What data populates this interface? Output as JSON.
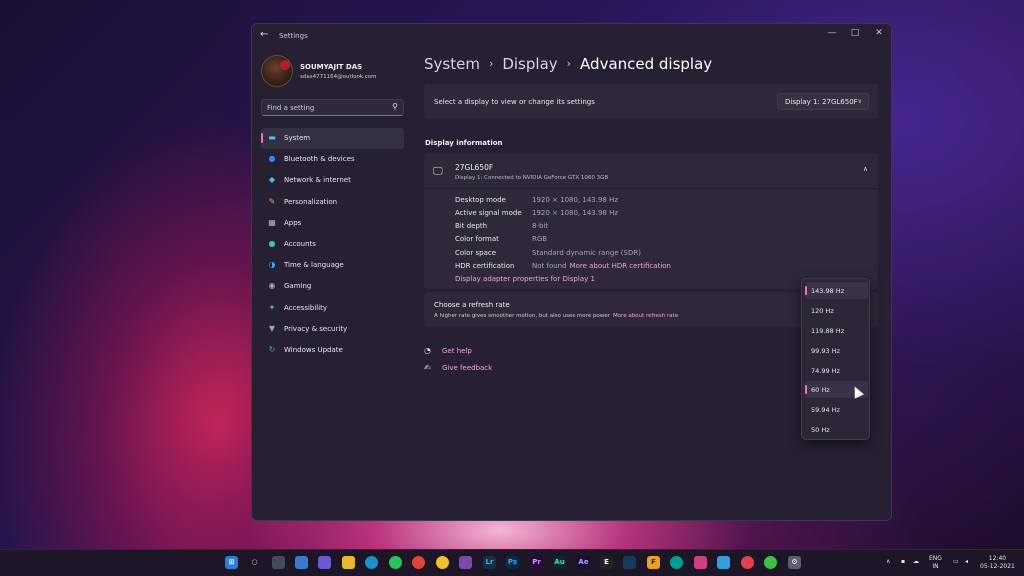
{
  "window": {
    "title": "Settings",
    "back_icon": "←",
    "min_icon": "—",
    "max_icon": "□",
    "close_icon": "✕"
  },
  "profile": {
    "name": "SOUMYAJIT DAS",
    "email": "sdas4771164@outlook.com"
  },
  "search": {
    "placeholder": "Find a setting",
    "icon": "⚲"
  },
  "sidebar": {
    "items": [
      {
        "label": "System",
        "icon": "▬",
        "color": "#4cc2ff"
      },
      {
        "label": "Bluetooth & devices",
        "icon": "●",
        "color": "#2f8cff"
      },
      {
        "label": "Network & internet",
        "icon": "◆",
        "color": "#54b6f6"
      },
      {
        "label": "Personalization",
        "icon": "✎",
        "color": "#f0a050"
      },
      {
        "label": "Apps",
        "icon": "▦",
        "color": "#b0b8d8"
      },
      {
        "label": "Accounts",
        "icon": "●",
        "color": "#3cc8a0"
      },
      {
        "label": "Time & language",
        "icon": "◑",
        "color": "#3aa6f0"
      },
      {
        "label": "Gaming",
        "icon": "◉",
        "color": "#a8a8b8"
      },
      {
        "label": "Accessibility",
        "icon": "✦",
        "color": "#4ab0ff"
      },
      {
        "label": "Privacy & security",
        "icon": "▼",
        "color": "#9aa0b0"
      },
      {
        "label": "Windows Update",
        "icon": "↻",
        "color": "#3aa0f0"
      }
    ]
  },
  "breadcrumb": {
    "part1": "System",
    "part2": "Display",
    "current": "Advanced display",
    "sep": "›"
  },
  "display_select": {
    "label": "Select a display to view or change its settings",
    "value": "Display 1: 27GL650F",
    "chevron": "∨"
  },
  "display_info": {
    "section_title": "Display information",
    "name": "27GL650F",
    "subtitle": "Display 1: Connected to NVIDIA GeForce GTX 1060 3GB",
    "chevron": "∧",
    "rows": [
      {
        "key": "Desktop mode",
        "value": "1920 × 1080, 143.98 Hz"
      },
      {
        "key": "Active signal mode",
        "value": "1920 × 1080, 143.98 Hz"
      },
      {
        "key": "Bit depth",
        "value": "8-bit"
      },
      {
        "key": "Color format",
        "value": "RGB"
      },
      {
        "key": "Color space",
        "value": "Standard dynamic range (SDR)"
      },
      {
        "key": "HDR certification",
        "value": "Not found",
        "link": "More about HDR certification"
      }
    ],
    "adapter_link": "Display adapter properties for Display 1"
  },
  "refresh": {
    "title": "Choose a refresh rate",
    "subtitle": "A higher rate gives smoother motion, but also uses more power",
    "link": "More about refresh rate",
    "options": [
      "143.98 Hz",
      "120 Hz",
      "119.88 Hz",
      "99.93 Hz",
      "74.99 Hz",
      "60 Hz",
      "59.94 Hz",
      "50 Hz"
    ],
    "selected": "143.98 Hz"
  },
  "help": {
    "get_help": "Get help",
    "feedback": "Give feedback"
  },
  "taskbar": {
    "lang_top": "ENG",
    "lang_bottom": "IN",
    "time": "12:40",
    "date": "05-12-2021",
    "chevron": "∧"
  }
}
